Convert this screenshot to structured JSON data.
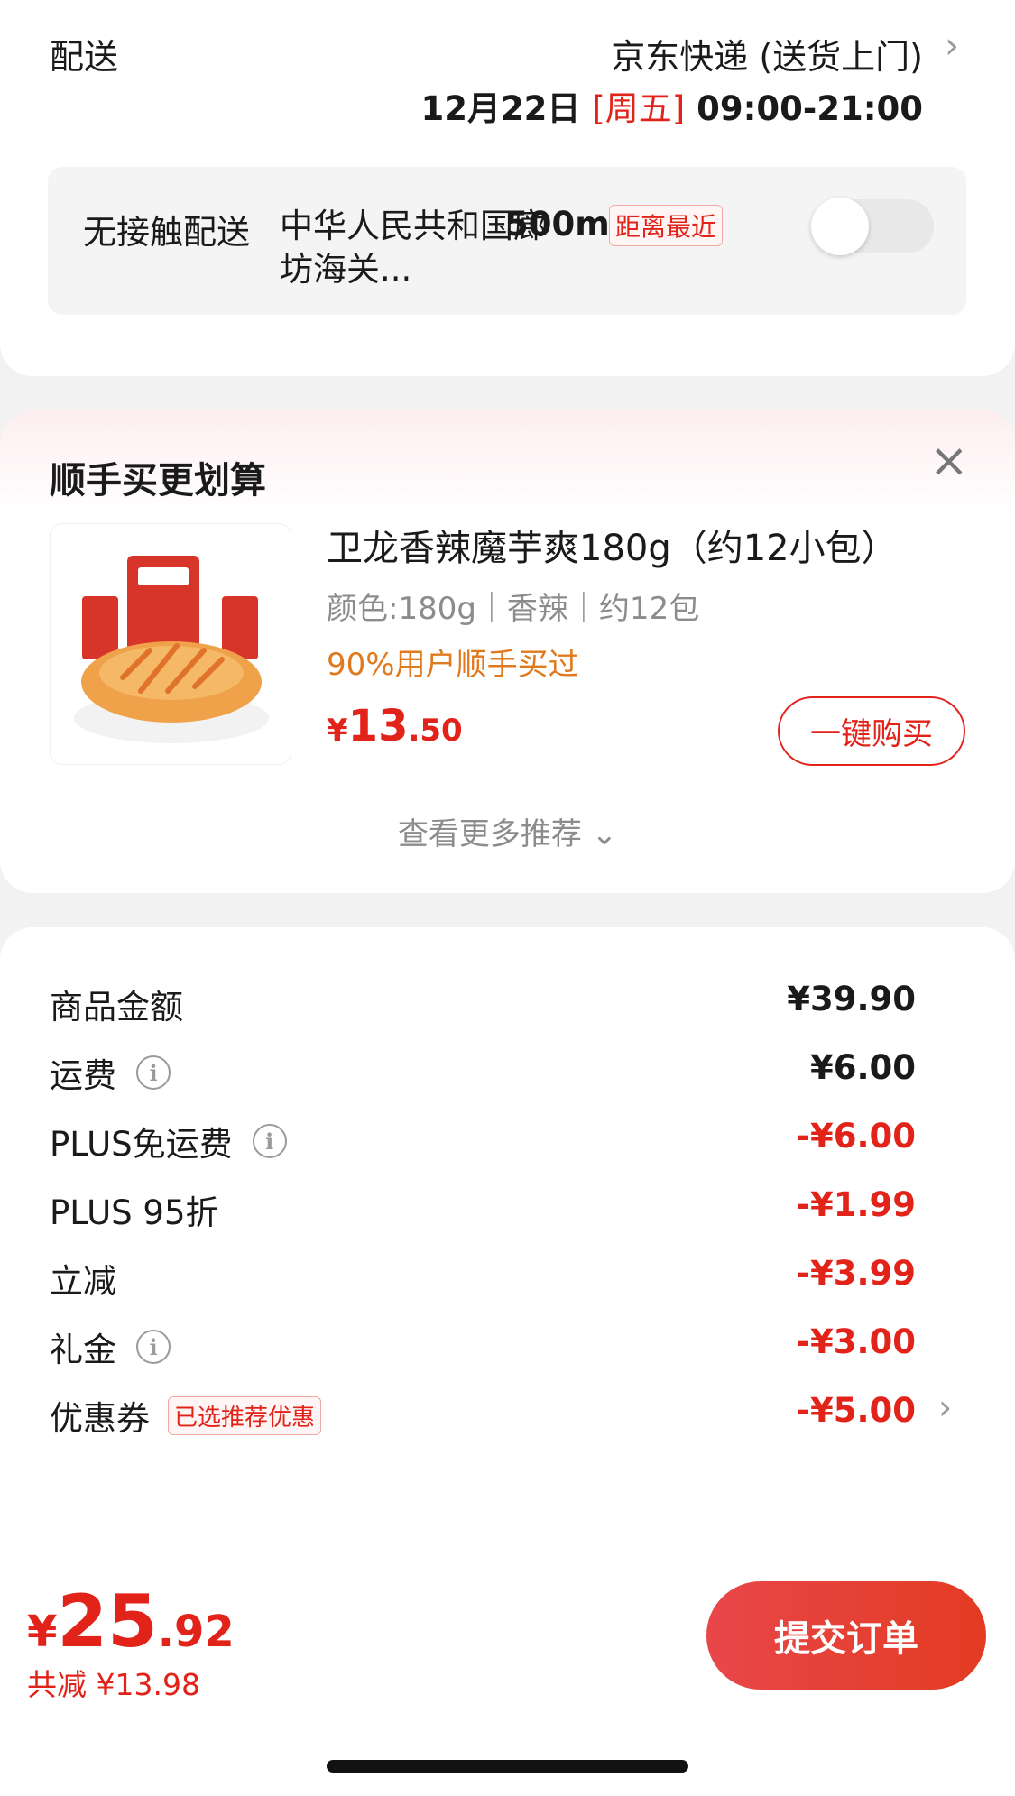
{
  "delivery": {
    "label": "配送",
    "method": "京东快递 (送货上门)",
    "date": "12月22日",
    "weekday": "[周五]",
    "time": "09:00-21:00",
    "no_contact": {
      "title": "无接触配送",
      "address": "中华人民共和国廊坊海关...",
      "distance": "500m",
      "tag": "距离最近",
      "toggle_on": false
    }
  },
  "recommend": {
    "title": "顺手买更划算",
    "product": {
      "name": "卫龙香辣魔芋爽180g（约12小包）",
      "spec": "颜色:180g｜香辣｜约12包",
      "hint": "90%用户顺手买过",
      "price_currency": "¥",
      "price_int": "13",
      "price_dec": ".50",
      "buy_label": "一键购买"
    },
    "more_label": "查看更多推荐 ⌄"
  },
  "price": {
    "rows": [
      {
        "label": "商品金额",
        "value": "¥39.90"
      },
      {
        "label": "运费",
        "value": "¥6.00"
      },
      {
        "label": "PLUS免运费",
        "value": "-¥6.00"
      },
      {
        "label": "PLUS 95折",
        "value": "-¥1.99"
      },
      {
        "label": "立减",
        "value": "-¥3.99"
      },
      {
        "label": "礼金",
        "value": "-¥3.00"
      },
      {
        "label": "优惠券",
        "value": "-¥5.00",
        "tag": "已选推荐优惠"
      }
    ]
  },
  "bottom": {
    "total_currency": "¥",
    "total_int": "25",
    "total_dec": ".92",
    "saved": "共减 ¥13.98",
    "submit_label": "提交订单"
  },
  "colors": {
    "accent": "#e2231a",
    "orange_hint": "#e07a1f",
    "background": "#f2f2f2"
  }
}
